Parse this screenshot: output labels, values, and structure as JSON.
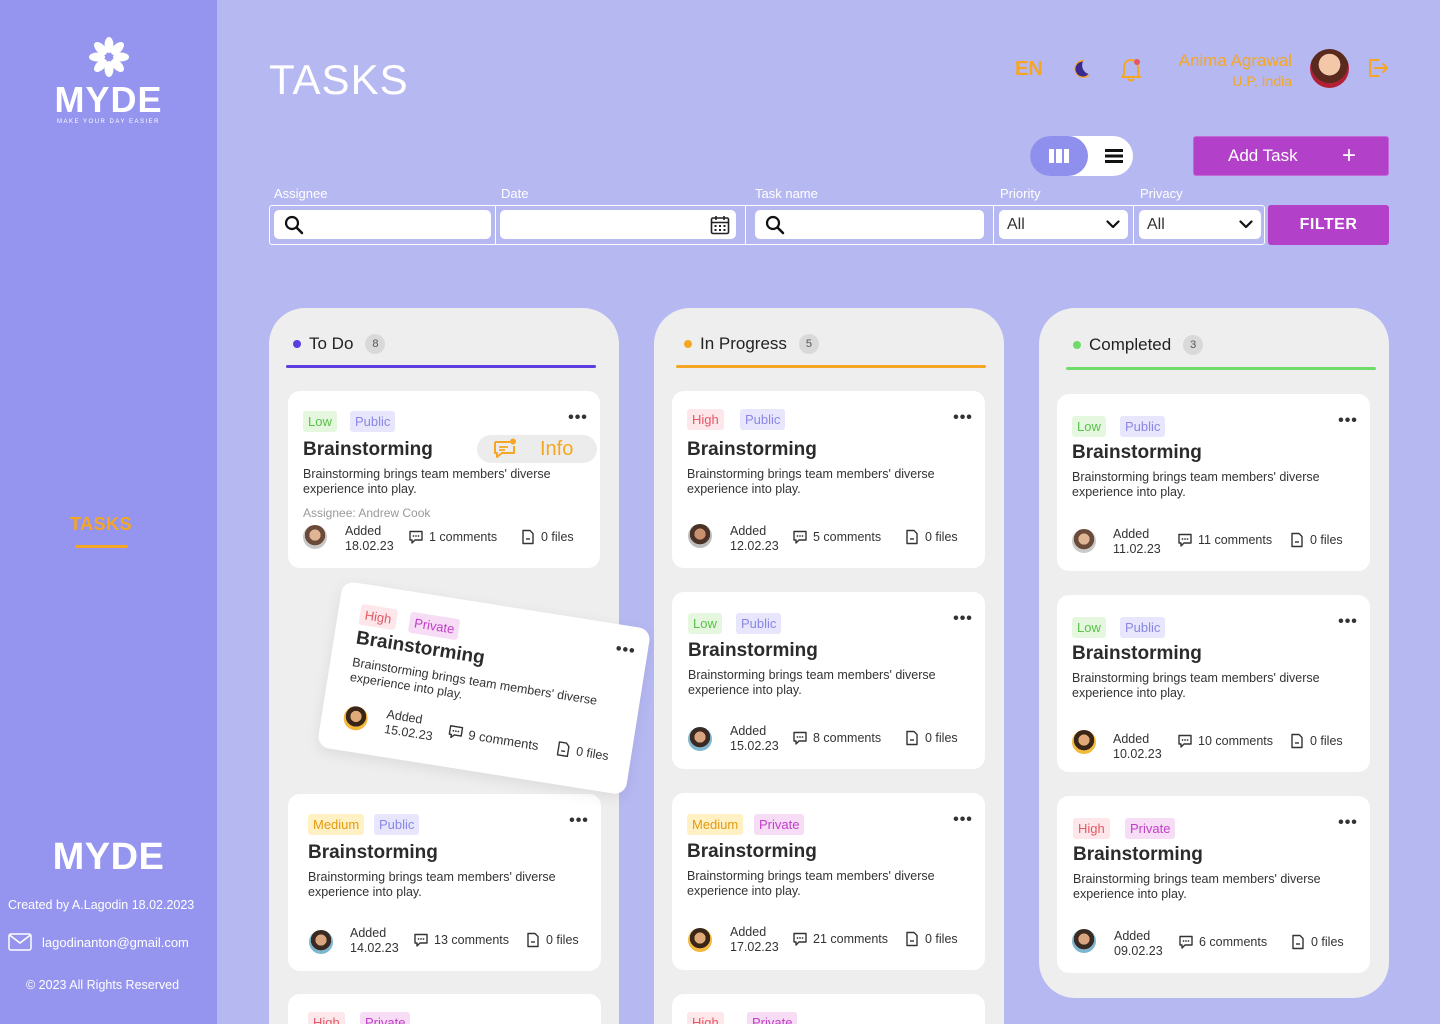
{
  "app": {
    "logo_text": "MYDE",
    "logo_tagline": "MAKE YOUR DAY EASIER",
    "nav_tasks": "TASKS",
    "footer_title": "MYDE",
    "created_by": "Created by A.Lagodin 18.02.2023",
    "email": "lagodinanton@gmail.com",
    "copyright": "© 2023 All Rights Reserved"
  },
  "header": {
    "title": "TASKS",
    "language": "EN",
    "user_name": "Anima Agrawal",
    "user_location": "U.P, India",
    "icons": [
      "moon-icon",
      "bell-icon",
      "logout-icon"
    ]
  },
  "toolbar": {
    "add_task_label": "Add Task",
    "add_task_icon": "+",
    "filter_label": "FILTER",
    "filters": {
      "assignee_label": "Assignee",
      "date_label": "Date",
      "task_name_label": "Task name",
      "priority_label": "Priority",
      "priority_value": "All",
      "privacy_label": "Privacy",
      "privacy_value": "All"
    }
  },
  "colors": {
    "accent": "#b340c9",
    "orange": "#f5a623",
    "todo": "#5b3de0",
    "in_progress": "#f5a623",
    "completed": "#6fdc6a"
  },
  "columns": [
    {
      "name": "To Do",
      "count": "8",
      "cards": [
        {
          "priority": "Low",
          "privacy": "Public",
          "title": "Brainstorming",
          "desc": "Brainstorming brings team members' diverse experience into play.",
          "assignee": "Assignee: Andrew Cook",
          "added_label": "Added",
          "date": "18.02.23",
          "comments": "1 comments",
          "files": "0 files",
          "info": "Info"
        },
        {
          "priority": "High",
          "privacy": "Private",
          "title": "Brainstorming",
          "desc": "Brainstorming brings team members' diverse experience into play.",
          "added_label": "Added",
          "date": "15.02.23",
          "comments": "9 comments",
          "files": "0 files"
        },
        {
          "priority": "Medium",
          "privacy": "Public",
          "title": "Brainstorming",
          "desc": "Brainstorming brings team members' diverse experience into play.",
          "added_label": "Added",
          "date": "14.02.23",
          "comments": "13 comments",
          "files": "0 files"
        },
        {
          "priority": "High",
          "privacy": "Private"
        }
      ]
    },
    {
      "name": "In Progress",
      "count": "5",
      "cards": [
        {
          "priority": "High",
          "privacy": "Public",
          "title": "Brainstorming",
          "desc": "Brainstorming brings team members' diverse experience into play.",
          "added_label": "Added",
          "date": "12.02.23",
          "comments": "5 comments",
          "files": "0 files"
        },
        {
          "priority": "Low",
          "privacy": "Public",
          "title": "Brainstorming",
          "desc": "Brainstorming brings team members' diverse experience into play.",
          "added_label": "Added",
          "date": "15.02.23",
          "comments": "8 comments",
          "files": "0 files"
        },
        {
          "priority": "Medium",
          "privacy": "Private",
          "title": "Brainstorming",
          "desc": "Brainstorming brings team members' diverse experience into play.",
          "added_label": "Added",
          "date": "17.02.23",
          "comments": "21 comments",
          "files": "0 files"
        },
        {
          "priority": "High",
          "privacy": "Private"
        }
      ]
    },
    {
      "name": "Completed",
      "count": "3",
      "cards": [
        {
          "priority": "Low",
          "privacy": "Public",
          "title": "Brainstorming",
          "desc": "Brainstorming brings team members' diverse experience into play.",
          "added_label": "Added",
          "date": "11.02.23",
          "comments": "11 comments",
          "files": "0 files"
        },
        {
          "priority": "Low",
          "privacy": "Public",
          "title": "Brainstorming",
          "desc": "Brainstorming brings team members' diverse experience into play.",
          "added_label": "Added",
          "date": "10.02.23",
          "comments": "10 comments",
          "files": "0 files"
        },
        {
          "priority": "High",
          "privacy": "Private",
          "title": "Brainstorming",
          "desc": "Brainstorming brings team members' diverse experience into play.",
          "added_label": "Added",
          "date": "09.02.23",
          "comments": "6 comments",
          "files": "0 files"
        }
      ]
    }
  ]
}
